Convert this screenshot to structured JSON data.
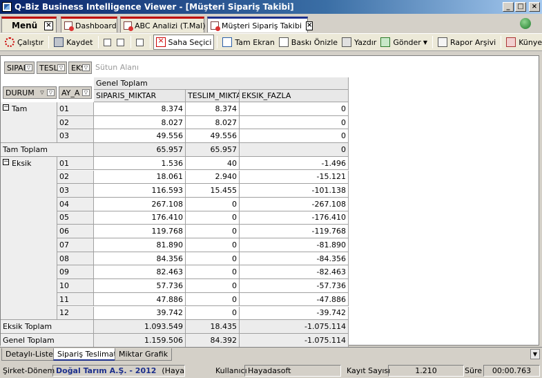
{
  "window": {
    "title": "Q-Biz Business Intelligence Viewer - [Müşteri Sipariş Takibi]"
  },
  "tabs": {
    "menu": "Menü",
    "dashboard": "Dashboard",
    "abc": "ABC Analizi (T.Mal)",
    "current": "Müşteri Sipariş Takibi"
  },
  "toolbar": {
    "calistir": "Çalıştır",
    "kaydet": "Kaydet",
    "saha_secici": "Saha Seçici",
    "tam_ekran": "Tam Ekran",
    "baski_onizle": "Baskı Önizle",
    "yazdir": "Yazdır",
    "gonder": "Gönder",
    "rapor_arsivi": "Rapor Arşivi",
    "kunye": "Künye"
  },
  "pivot": {
    "filter_fields": [
      "SIPAF",
      "TESLI",
      "EKS"
    ],
    "column_area_label": "Sütun Alanı",
    "row_fields": [
      "DURUM",
      "AY_A"
    ],
    "column_group": "Genel Toplam",
    "columns": [
      "SIPARIS_MIKTAR",
      "TESLIM_MIKTARI",
      "EKSIK_FAZLA"
    ],
    "groups": [
      {
        "name": "Tam",
        "rows": [
          {
            "month": "01",
            "values": [
              "8.374",
              "8.374",
              "0"
            ]
          },
          {
            "month": "02",
            "values": [
              "8.027",
              "8.027",
              "0"
            ]
          },
          {
            "month": "03",
            "values": [
              "49.556",
              "49.556",
              "0"
            ]
          }
        ],
        "total_label": "Tam Toplam",
        "total": [
          "65.957",
          "65.957",
          "0"
        ]
      },
      {
        "name": "Eksik",
        "rows": [
          {
            "month": "01",
            "values": [
              "1.536",
              "40",
              "-1.496"
            ]
          },
          {
            "month": "02",
            "values": [
              "18.061",
              "2.940",
              "-15.121"
            ]
          },
          {
            "month": "03",
            "values": [
              "116.593",
              "15.455",
              "-101.138"
            ]
          },
          {
            "month": "04",
            "values": [
              "267.108",
              "0",
              "-267.108"
            ]
          },
          {
            "month": "05",
            "values": [
              "176.410",
              "0",
              "-176.410"
            ]
          },
          {
            "month": "06",
            "values": [
              "119.768",
              "0",
              "-119.768"
            ]
          },
          {
            "month": "07",
            "values": [
              "81.890",
              "0",
              "-81.890"
            ]
          },
          {
            "month": "08",
            "values": [
              "84.356",
              "0",
              "-84.356"
            ]
          },
          {
            "month": "09",
            "values": [
              "82.463",
              "0",
              "-82.463"
            ]
          },
          {
            "month": "10",
            "values": [
              "57.736",
              "0",
              "-57.736"
            ]
          },
          {
            "month": "11",
            "values": [
              "47.886",
              "0",
              "-47.886"
            ]
          },
          {
            "month": "12",
            "values": [
              "39.742",
              "0",
              "-39.742"
            ]
          }
        ],
        "total_label": "Eksik Toplam",
        "total": [
          "1.093.549",
          "18.435",
          "-1.075.114"
        ]
      }
    ],
    "grand_total_label": "Genel Toplam",
    "grand_total": [
      "1.159.506",
      "84.392",
      "-1.075.114"
    ]
  },
  "bottom_tabs": [
    "Detaylı-Liste",
    "Sipariş Teslimat",
    "Miktar Grafik"
  ],
  "status": {
    "sirket_label": "Şirket-Dönem",
    "sirket_value": "Doğal Tarım A.Ş. - 2012",
    "sirket_extra": "(Hayadas",
    "kullanici_label": "Kullanıcı",
    "kullanici_value": "Hayadasoft",
    "kayit_label": "Kayıt Sayısı",
    "kayit_value": "1.210",
    "sure_label": "Süre",
    "sure_value": "00:00.763"
  }
}
